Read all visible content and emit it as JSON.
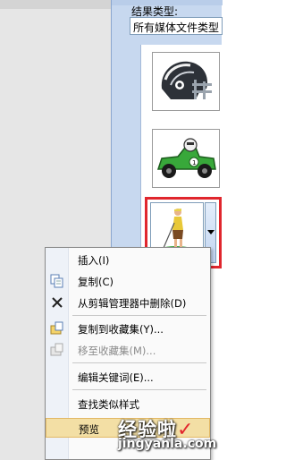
{
  "pane": {
    "results_type_label": "结果类型:",
    "results_type_value": "所有媒体文件类型"
  },
  "thumbnails": [
    {
      "name": "football-helmet-clipart"
    },
    {
      "name": "race-car-clipart"
    },
    {
      "name": "golfer-clipart",
      "selected": true
    }
  ],
  "context_menu": {
    "items": [
      {
        "label": "插入(I)",
        "icon": "none",
        "enabled": true
      },
      {
        "label": "复制(C)",
        "icon": "copy-icon",
        "enabled": true
      },
      {
        "label": "从剪辑管理器中删除(D)",
        "icon": "delete-x-icon",
        "enabled": true
      },
      {
        "label": "复制到收藏集(Y)...",
        "icon": "copy-to-collection-icon",
        "enabled": true
      },
      {
        "label": "移至收藏集(M)...",
        "icon": "move-to-collection-icon",
        "enabled": false
      },
      {
        "label": "编辑关键词(E)...",
        "icon": "none",
        "enabled": true
      },
      {
        "label": "查找类似样式",
        "icon": "none",
        "enabled": true
      },
      {
        "label": "预览",
        "icon": "none",
        "enabled": true,
        "highlighted": true
      }
    ]
  },
  "watermark": {
    "cn": "经验啦",
    "en": "jingyanla.com",
    "check": "✓"
  },
  "colors": {
    "pane_bg": "#c7d8ef",
    "selection_border": "#e0262d",
    "menu_highlight": "#f3dfa5"
  }
}
